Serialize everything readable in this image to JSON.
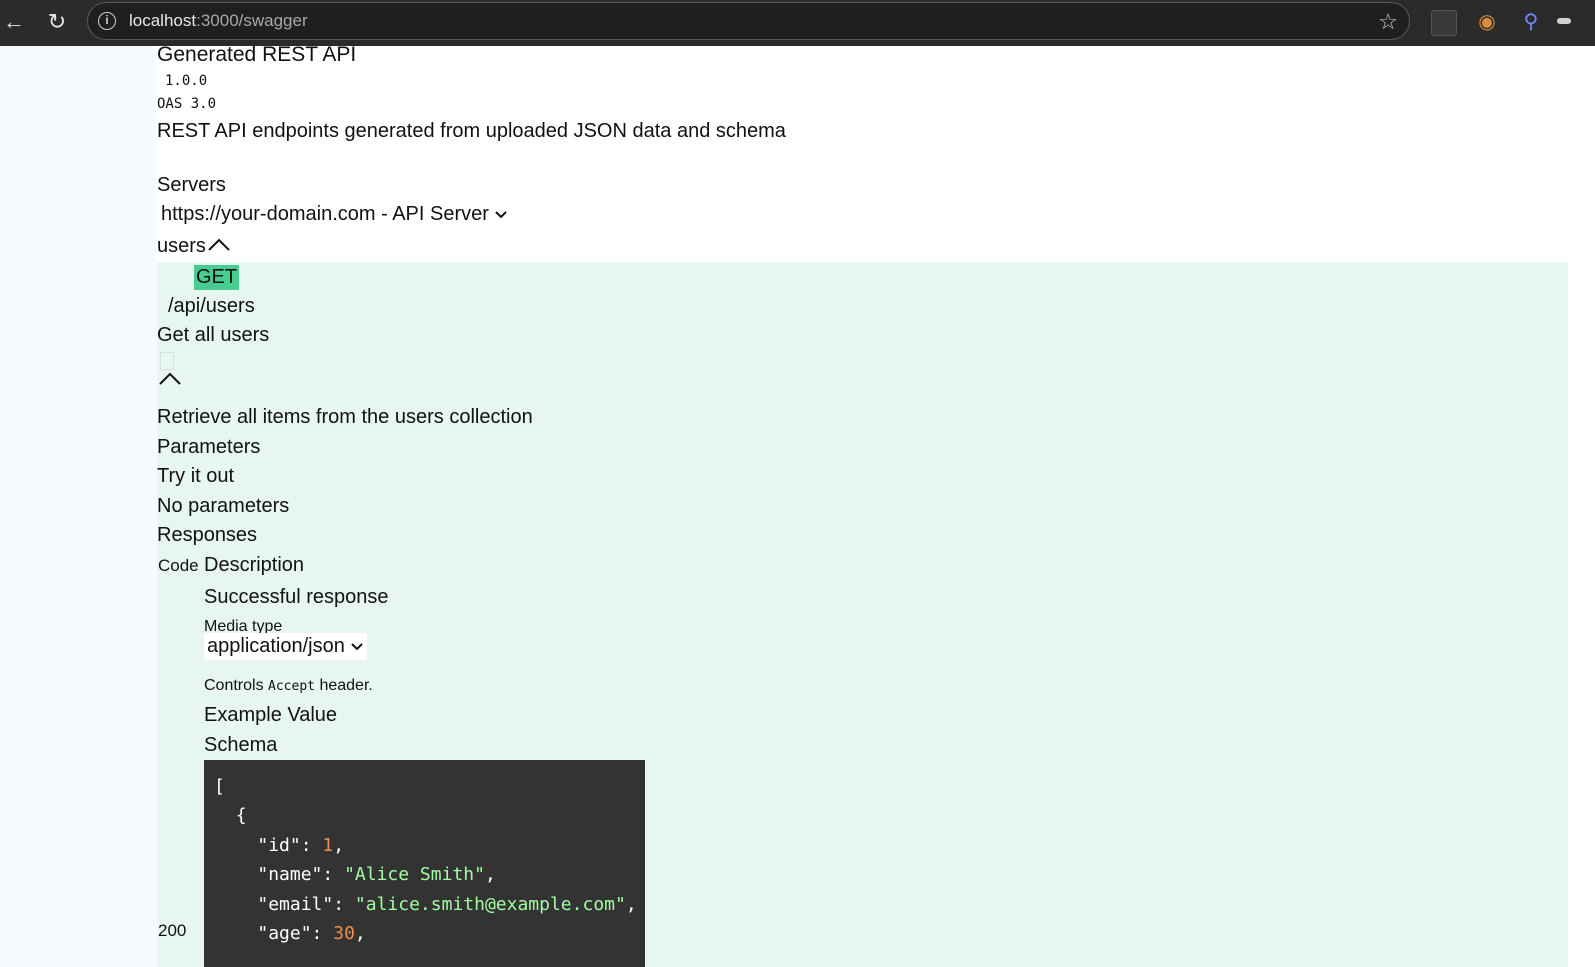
{
  "browser": {
    "url_host": "localhost",
    "url_rest": ":3000/swagger",
    "icons": [
      "back-arrow-icon",
      "reload-icon",
      "info-icon",
      "star-icon",
      "extension-icon",
      "cookie-icon",
      "search-extension-icon",
      "menu-icon"
    ]
  },
  "info": {
    "title": "Generated REST API",
    "version": "1.0.0",
    "oas": "OAS 3.0",
    "description": "REST API endpoints generated from uploaded JSON data and schema"
  },
  "servers": {
    "label": "Servers",
    "selected": "https://your-domain.com - API Server"
  },
  "tag": {
    "name": "users"
  },
  "operation": {
    "method": "GET",
    "method_color": "#49cc90",
    "path": "/api/users",
    "summary": "Get all users",
    "description": "Retrieve all items from the users collection",
    "parameters_label": "Parameters",
    "try_it_out": "Try it out",
    "no_parameters": "No parameters",
    "responses_label": "Responses",
    "columns": {
      "code": "Code",
      "description": "Description"
    },
    "response": {
      "code": "200",
      "description": "Successful response",
      "media_type_label": "Media type",
      "media_type": "application/json",
      "controls_prefix": "Controls ",
      "controls_code": "Accept",
      "controls_suffix": " header.",
      "example_value_tab": "Example Value",
      "schema_tab": "Schema",
      "example_lines": [
        {
          "indent": "",
          "parts": [
            {
              "t": "[",
              "c": "key"
            }
          ]
        },
        {
          "indent": "  ",
          "parts": [
            {
              "t": "{",
              "c": "key"
            }
          ]
        },
        {
          "indent": "    ",
          "parts": [
            {
              "t": "\"id\"",
              "c": "key"
            },
            {
              "t": ": ",
              "c": "key"
            },
            {
              "t": "1",
              "c": "num"
            },
            {
              "t": ",",
              "c": "key"
            }
          ]
        },
        {
          "indent": "    ",
          "parts": [
            {
              "t": "\"name\"",
              "c": "key"
            },
            {
              "t": ": ",
              "c": "key"
            },
            {
              "t": "\"Alice Smith\"",
              "c": "str"
            },
            {
              "t": ",",
              "c": "key"
            }
          ]
        },
        {
          "indent": "    ",
          "parts": [
            {
              "t": "\"email\"",
              "c": "key"
            },
            {
              "t": ": ",
              "c": "key"
            },
            {
              "t": "\"alice.smith@example.com\"",
              "c": "str"
            },
            {
              "t": ",",
              "c": "key"
            }
          ]
        },
        {
          "indent": "    ",
          "parts": [
            {
              "t": "\"age\"",
              "c": "key"
            },
            {
              "t": ": ",
              "c": "key"
            },
            {
              "t": "30",
              "c": "num"
            },
            {
              "t": ",",
              "c": "key"
            }
          ]
        }
      ]
    }
  }
}
